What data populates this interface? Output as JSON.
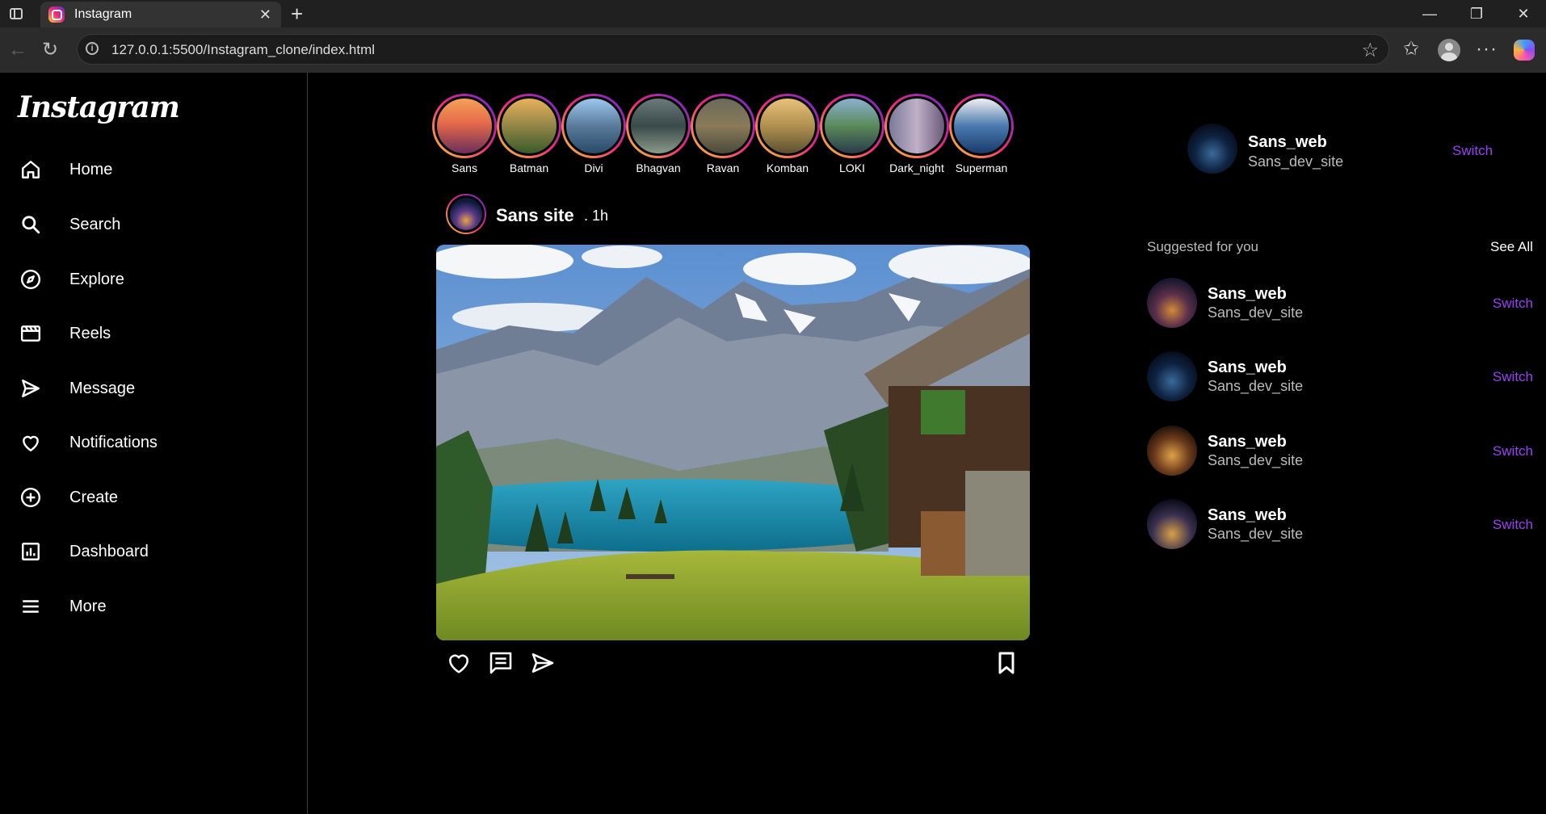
{
  "browser": {
    "tab_title": "Instagram",
    "url": "127.0.0.1:5500/Instagram_clone/index.html",
    "new_tab": "+",
    "close": "✕"
  },
  "sidebar": {
    "logo": "Instagram",
    "items": [
      {
        "label": "Home",
        "icon": "home-icon"
      },
      {
        "label": "Search",
        "icon": "search-icon"
      },
      {
        "label": "Explore",
        "icon": "explore-icon"
      },
      {
        "label": "Reels",
        "icon": "reels-icon"
      },
      {
        "label": "Message",
        "icon": "send-icon"
      },
      {
        "label": "Notifications",
        "icon": "heart-icon"
      },
      {
        "label": "Create",
        "icon": "plus-circle-icon"
      },
      {
        "label": "Dashboard",
        "icon": "dashboard-icon"
      },
      {
        "label": "More",
        "icon": "menu-icon"
      }
    ]
  },
  "stories": [
    {
      "name": "Sans"
    },
    {
      "name": "Batman"
    },
    {
      "name": "Divi"
    },
    {
      "name": "Bhagvan"
    },
    {
      "name": "Ravan"
    },
    {
      "name": "Komban"
    },
    {
      "name": "LOKI"
    },
    {
      "name": "Dark_night"
    },
    {
      "name": "Superman"
    }
  ],
  "post": {
    "username": "Sans site",
    "time": ". 1h"
  },
  "profile": {
    "name": "Sans_web",
    "handle": "Sans_dev_site",
    "action": "Switch"
  },
  "suggestions": {
    "title": "Suggested for you",
    "see_all": "See All",
    "items": [
      {
        "name": "Sans_web",
        "handle": "Sans_dev_site",
        "action": "Switch"
      },
      {
        "name": "Sans_web",
        "handle": "Sans_dev_site",
        "action": "Switch"
      },
      {
        "name": "Sans_web",
        "handle": "Sans_dev_site",
        "action": "Switch"
      },
      {
        "name": "Sans_web",
        "handle": "Sans_dev_site",
        "action": "Switch"
      }
    ]
  },
  "colors": {
    "accent": "#9b41f5",
    "background": "#000000",
    "story_ring": "#ee2a7b"
  }
}
